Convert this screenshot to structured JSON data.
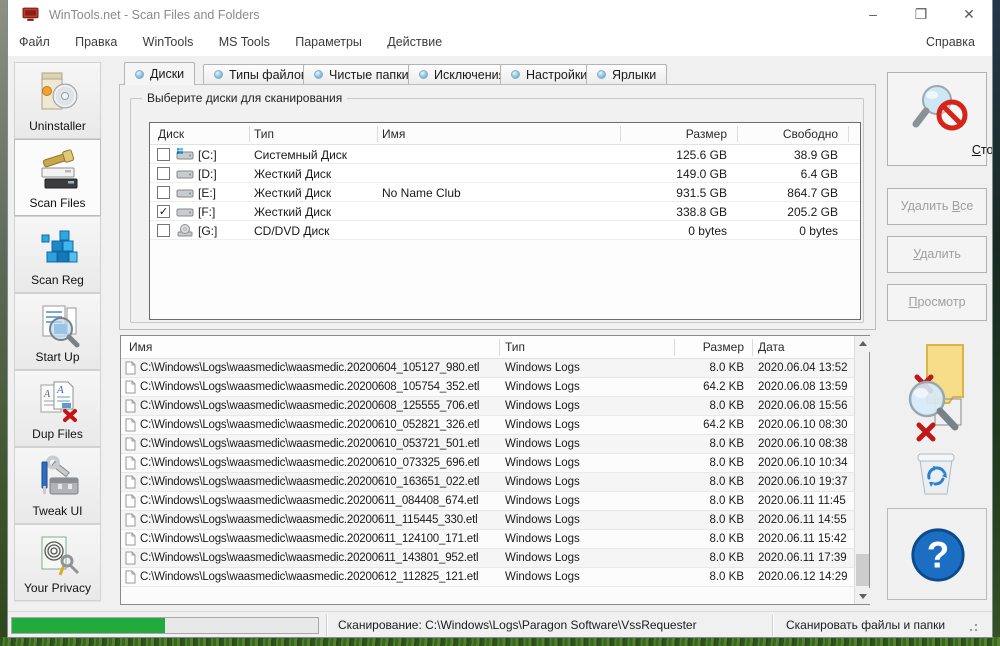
{
  "window": {
    "title": "WinTools.net - Scan Files and Folders",
    "controls": {
      "minimize": "–",
      "maximize": "❐",
      "close": "✕"
    }
  },
  "menu": {
    "items": [
      "Файл",
      "Правка",
      "WinTools",
      "MS Tools",
      "Параметры",
      "Действие"
    ],
    "right_item": "Справка"
  },
  "sidebar": {
    "items": [
      {
        "label": "Uninstaller",
        "active": false
      },
      {
        "label": "Scan Files",
        "active": true
      },
      {
        "label": "Scan Reg",
        "active": false
      },
      {
        "label": "Start Up",
        "active": false
      },
      {
        "label": "Dup Files",
        "active": false
      },
      {
        "label": "Tweak UI",
        "active": false
      },
      {
        "label": "Your Privacy",
        "active": false
      }
    ]
  },
  "tabs": [
    {
      "label": "Диски",
      "active": true
    },
    {
      "label": "Типы файлов",
      "active": false
    },
    {
      "label": "Чистые папки",
      "active": false
    },
    {
      "label": "Исключения",
      "active": false
    },
    {
      "label": "Настройки",
      "active": false
    },
    {
      "label": "Ярлыки",
      "active": false
    }
  ],
  "drives_panel": {
    "groupbox_title": "Выберите диски для сканирования",
    "columns": {
      "drive": "Диск",
      "type": "Тип",
      "name": "Имя",
      "size": "Размер",
      "free": "Свободно"
    },
    "rows": [
      {
        "checked": "",
        "letter": "[C:]",
        "icon": "system-drive",
        "type": "Системный Диск",
        "name": "",
        "size": "125.6 GB",
        "free": "38.9 GB"
      },
      {
        "checked": "",
        "letter": "[D:]",
        "icon": "hard-drive",
        "type": "Жесткий Диск",
        "name": "",
        "size": "149.0 GB",
        "free": "6.4 GB"
      },
      {
        "checked": "",
        "letter": "[E:]",
        "icon": "hard-drive",
        "type": "Жесткий Диск",
        "name": "No Name Club",
        "size": "931.5 GB",
        "free": "864.7 GB"
      },
      {
        "checked": "✓",
        "letter": "[F:]",
        "icon": "hard-drive",
        "type": "Жесткий Диск",
        "name": "",
        "size": "338.8 GB",
        "free": "205.2 GB"
      },
      {
        "checked": "",
        "letter": "[G:]",
        "icon": "cd-drive",
        "type": "CD/DVD Диск",
        "name": "",
        "size": "0 bytes",
        "free": "0 bytes"
      }
    ]
  },
  "files_panel": {
    "columns": {
      "name": "Имя",
      "type": "Тип",
      "size": "Размер",
      "date": "Дата"
    },
    "rows": [
      {
        "name": "C:\\Windows\\Logs\\waasmedic\\waasmedic.20200604_105127_980.etl",
        "type": "Windows Logs",
        "size": "8.0 KB",
        "date": "2020.06.04 13:52"
      },
      {
        "name": "C:\\Windows\\Logs\\waasmedic\\waasmedic.20200608_105754_352.etl",
        "type": "Windows Logs",
        "size": "64.2 KB",
        "date": "2020.06.08 13:59"
      },
      {
        "name": "C:\\Windows\\Logs\\waasmedic\\waasmedic.20200608_125555_706.etl",
        "type": "Windows Logs",
        "size": "8.0 KB",
        "date": "2020.06.08 15:56"
      },
      {
        "name": "C:\\Windows\\Logs\\waasmedic\\waasmedic.20200610_052821_326.etl",
        "type": "Windows Logs",
        "size": "64.2 KB",
        "date": "2020.06.10 08:30"
      },
      {
        "name": "C:\\Windows\\Logs\\waasmedic\\waasmedic.20200610_053721_501.etl",
        "type": "Windows Logs",
        "size": "8.0 KB",
        "date": "2020.06.10 08:38"
      },
      {
        "name": "C:\\Windows\\Logs\\waasmedic\\waasmedic.20200610_073325_696.etl",
        "type": "Windows Logs",
        "size": "8.0 KB",
        "date": "2020.06.10 10:34"
      },
      {
        "name": "C:\\Windows\\Logs\\waasmedic\\waasmedic.20200610_163651_022.etl",
        "type": "Windows Logs",
        "size": "8.0 KB",
        "date": "2020.06.10 19:37"
      },
      {
        "name": "C:\\Windows\\Logs\\waasmedic\\waasmedic.20200611_084408_674.etl",
        "type": "Windows Logs",
        "size": "8.0 KB",
        "date": "2020.06.11 11:45"
      },
      {
        "name": "C:\\Windows\\Logs\\waasmedic\\waasmedic.20200611_115445_330.etl",
        "type": "Windows Logs",
        "size": "8.0 KB",
        "date": "2020.06.11 14:55"
      },
      {
        "name": "C:\\Windows\\Logs\\waasmedic\\waasmedic.20200611_124100_171.etl",
        "type": "Windows Logs",
        "size": "8.0 KB",
        "date": "2020.06.11 15:42"
      },
      {
        "name": "C:\\Windows\\Logs\\waasmedic\\waasmedic.20200611_143801_952.etl",
        "type": "Windows Logs",
        "size": "8.0 KB",
        "date": "2020.06.11 17:39"
      },
      {
        "name": "C:\\Windows\\Logs\\waasmedic\\waasmedic.20200612_112825_121.etl",
        "type": "Windows Logs",
        "size": "8.0 KB",
        "date": "2020.06.12 14:29"
      }
    ]
  },
  "actions": {
    "stop": {
      "pre": "",
      "key": "С",
      "post": "топ"
    },
    "delete_all": {
      "pre": "Удалить ",
      "key": "В",
      "post": "се"
    },
    "delete": {
      "pre": "",
      "key": "У",
      "post": "далить"
    },
    "preview": {
      "pre": "",
      "key": "П",
      "post": "росмотр"
    }
  },
  "statusbar": {
    "progress_percent": 50,
    "scanning_label": "Сканирование: C:\\Windows\\Logs\\Paragon Software\\VssRequester",
    "mode_label": "Сканировать файлы и папки"
  },
  "colors": {
    "progress_green": "#21ab3d",
    "help_blue": "#1b6ec2",
    "stop_red": "#d62518",
    "folder_yellow": "#f7dd8a",
    "tab_dot_blue": "#92c8e8",
    "window_bg": "#f0f0f0"
  }
}
